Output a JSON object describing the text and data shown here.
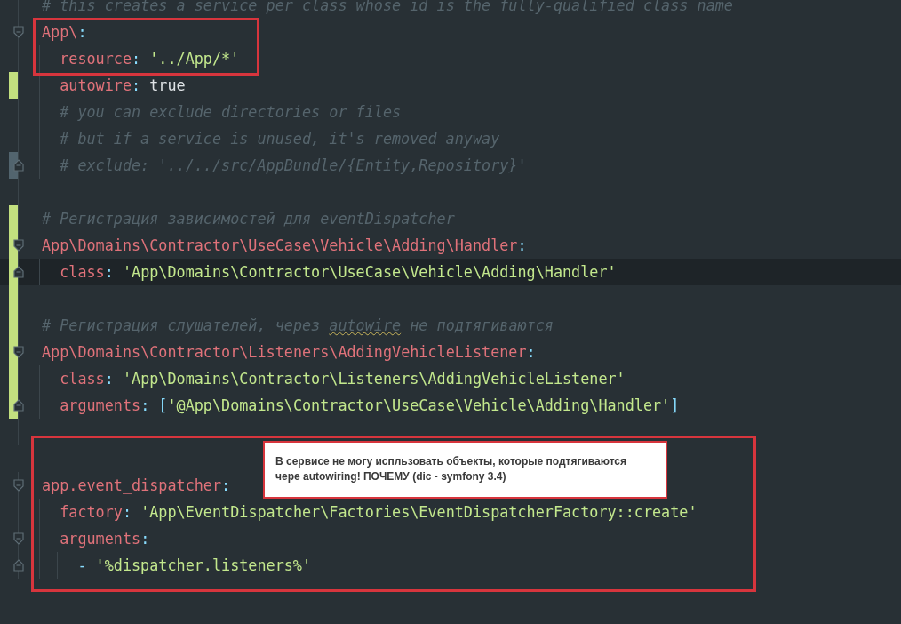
{
  "blocks": [
    {
      "lines": [
        {
          "tokens": [
            {
              "kind": "comment",
              "text": "# this creates a service per class whose id is the fully-qualified class name"
            }
          ]
        },
        {
          "fold_start": true,
          "tokens": [
            {
              "kind": "key",
              "text": "App\\"
            },
            {
              "kind": "punct",
              "text": ":"
            }
          ],
          "children": [
            {
              "tokens": [
                {
                  "kind": "key",
                  "text": "resource"
                },
                {
                  "kind": "punct",
                  "text": ": "
                },
                {
                  "kind": "string",
                  "text": "'../App/*'"
                }
              ]
            },
            {
              "added": true,
              "tokens": [
                {
                  "kind": "key",
                  "text": "autowire"
                },
                {
                  "kind": "punct",
                  "text": ": "
                },
                {
                  "kind": "value",
                  "text": "true"
                }
              ]
            },
            {
              "tokens": [
                {
                  "kind": "comment",
                  "text": "# you can exclude directories or files"
                }
              ]
            },
            {
              "tokens": [
                {
                  "kind": "comment",
                  "text": "# but if a service is unused, it's removed anyway"
                }
              ]
            },
            {
              "modified": true,
              "fold_end": true,
              "tokens": [
                {
                  "kind": "comment",
                  "text": "# exclude: '../../src/AppBundle/{Entity,Repository}'"
                }
              ]
            }
          ]
        }
      ]
    },
    {
      "gap_added": true,
      "lines": [
        {
          "added": true,
          "tokens": [
            {
              "kind": "comment",
              "text": "# Регистрация зависимостей для eventDispatcher"
            }
          ]
        },
        {
          "added": true,
          "fold_start": true,
          "tokens": [
            {
              "kind": "key",
              "text": "App\\Domains\\Contractor\\UseCase\\Vehicle\\Adding\\Handler"
            },
            {
              "kind": "punct",
              "text": ":"
            }
          ],
          "children": [
            {
              "added": true,
              "fold_end": true,
              "current": true,
              "tokens": [
                {
                  "kind": "key",
                  "text": "class"
                },
                {
                  "kind": "punct",
                  "text": ": "
                },
                {
                  "kind": "string",
                  "text": "'App\\Domains\\Contractor\\UseCase\\Vehicle\\Adding\\Handler'"
                }
              ]
            }
          ]
        }
      ]
    },
    {
      "lines": [
        {
          "added": true,
          "tokens": [
            {
              "kind": "comment",
              "text": "# Регистрация слушателей, через "
            },
            {
              "kind": "comment",
              "text": "autowire",
              "spell_warning": true
            },
            {
              "kind": "comment",
              "text": " не подтягиваются"
            }
          ]
        },
        {
          "added": true,
          "fold_start": true,
          "tokens": [
            {
              "kind": "key",
              "text": "App\\Domains\\Contractor\\Listeners\\AddingVehicleListener"
            },
            {
              "kind": "punct",
              "text": ":"
            }
          ],
          "children": [
            {
              "added": true,
              "tokens": [
                {
                  "kind": "key",
                  "text": "class"
                },
                {
                  "kind": "punct",
                  "text": ": "
                },
                {
                  "kind": "string",
                  "text": "'App\\Domains\\Contractor\\Listeners\\AddingVehicleListener'"
                }
              ]
            },
            {
              "added": true,
              "fold_end": true,
              "tokens": [
                {
                  "kind": "key",
                  "text": "arguments"
                },
                {
                  "kind": "punct",
                  "text": ": ["
                },
                {
                  "kind": "string",
                  "text": "'@App\\Domains\\Contractor\\UseCase\\Vehicle\\Adding\\Handler'"
                },
                {
                  "kind": "punct",
                  "text": "]"
                }
              ]
            }
          ]
        }
      ]
    },
    {
      "lines": [
        {
          "fold_start": true,
          "tokens": [
            {
              "kind": "key",
              "text": "app.event_dispatcher"
            },
            {
              "kind": "punct",
              "text": ":"
            }
          ],
          "children": [
            {
              "tokens": [
                {
                  "kind": "key",
                  "text": "factory"
                },
                {
                  "kind": "punct",
                  "text": ": "
                },
                {
                  "kind": "string",
                  "text": "'App\\EventDispatcher\\Factories\\EventDispatcherFactory::create'"
                }
              ]
            },
            {
              "fold_start": true,
              "tokens": [
                {
                  "kind": "key",
                  "text": "arguments"
                },
                {
                  "kind": "punct",
                  "text": ":"
                }
              ],
              "children": [
                {
                  "fold_end": true,
                  "tokens": [
                    {
                      "kind": "punct",
                      "text": "- "
                    },
                    {
                      "kind": "string",
                      "text": "'%dispatcher.listeners%'"
                    }
                  ]
                }
              ]
            }
          ]
        }
      ]
    }
  ],
  "annotations": [
    {
      "kind": "frame"
    },
    {
      "kind": "frame"
    },
    {
      "kind": "note",
      "text": "В сервисе не могу испльзовать объекты, которые подтягиваются чере autowiring! ПОЧЕМУ (dic - symfony 3.4)"
    }
  ]
}
